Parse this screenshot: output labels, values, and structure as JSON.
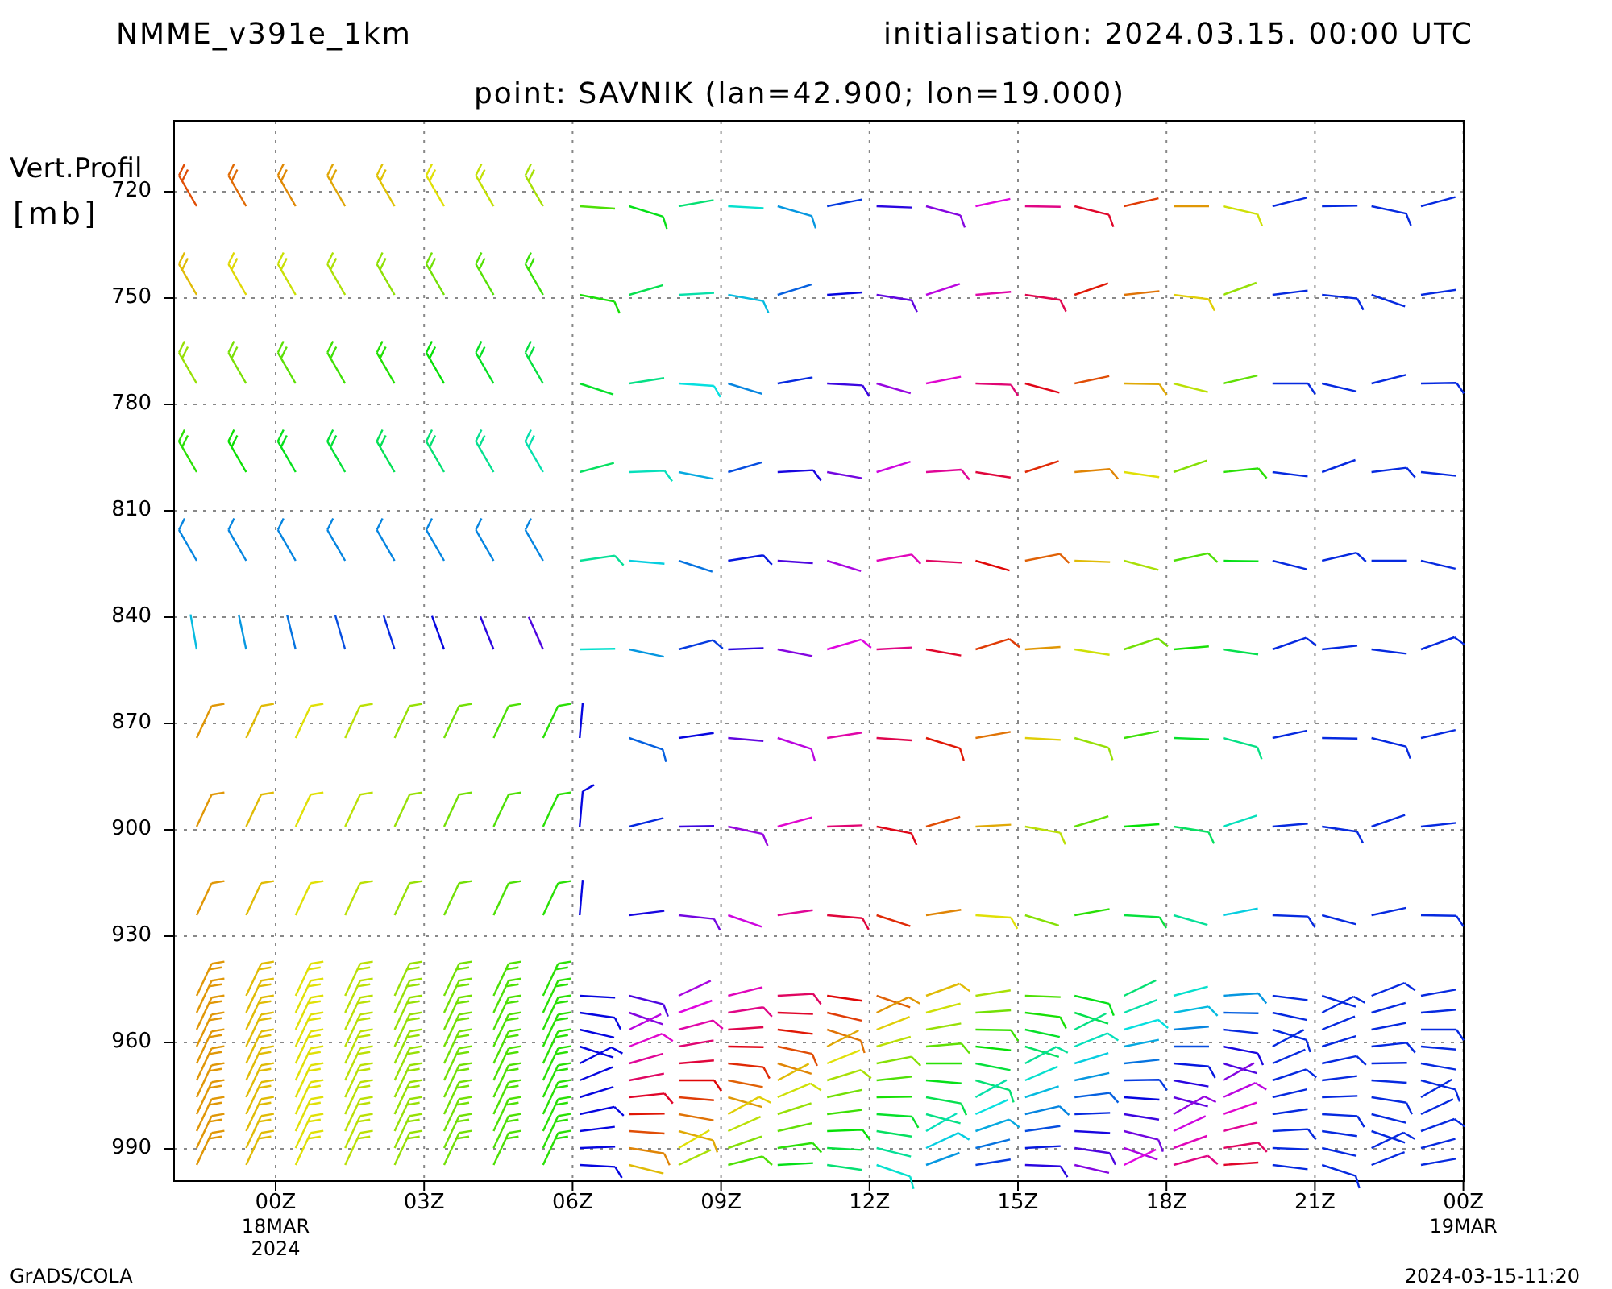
{
  "header": {
    "model": "NMME_v391e_1km",
    "initialisation": "initialisation: 2024.03.15. 00:00 UTC",
    "point": "point: SAVNIK (lan=42.900; lon=19.000)"
  },
  "y_axis": {
    "title_lines": [
      "Vert.Profil",
      "[mb]"
    ],
    "ticks": [
      "720",
      "750",
      "780",
      "810",
      "840",
      "870",
      "900",
      "930",
      "960",
      "990"
    ]
  },
  "x_axis": {
    "ticks": [
      {
        "label": "00Z",
        "sub": [
          "18MAR",
          "2024"
        ]
      },
      {
        "label": "03Z"
      },
      {
        "label": "06Z"
      },
      {
        "label": "09Z"
      },
      {
        "label": "12Z"
      },
      {
        "label": "15Z"
      },
      {
        "label": "18Z"
      },
      {
        "label": "21Z"
      },
      {
        "label": "00Z",
        "sub": [
          "19MAR"
        ]
      }
    ]
  },
  "footer": {
    "left": "GrADS/COLA",
    "right": "2024-03-15-11:20"
  }
}
